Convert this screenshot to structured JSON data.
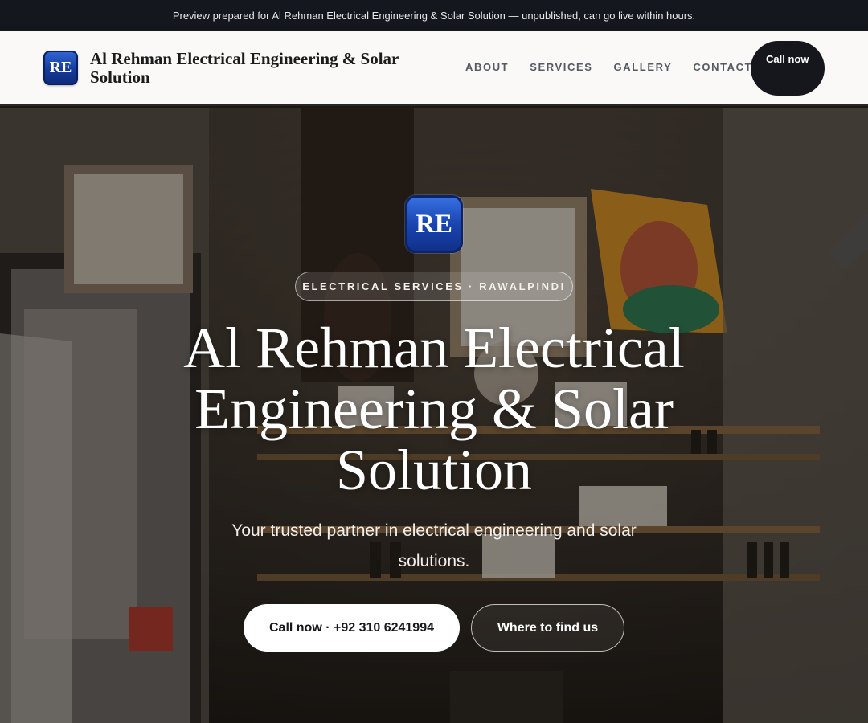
{
  "topbar": {
    "notice": "Preview prepared for Al Rehman Electrical Engineering & Solar Solution — unpublished, can go live within hours."
  },
  "header": {
    "logo_initials": "RE",
    "brand_name": "Al Rehman Electrical Engineering & Solar Solution",
    "nav": [
      {
        "label": "ABOUT"
      },
      {
        "label": "SERVICES"
      },
      {
        "label": "GALLERY"
      },
      {
        "label": "CONTACT"
      }
    ],
    "call_button": "Call now"
  },
  "hero": {
    "logo_initials": "RE",
    "tagline": "ELECTRICAL SERVICES · RAWALPINDI",
    "title": "Al Rehman Electrical Engineering & Solar Solution",
    "subtitle": "Your trusted partner in electrical engineering and solar solutions.",
    "primary_button": "Call now · +92 310 6241994",
    "secondary_button": "Where to find us"
  },
  "colors": {
    "topbar_bg": "#14171d",
    "nav_bg": "#faf9f7",
    "accent_blue": "#1a45b0",
    "call_button_bg": "#15171c"
  }
}
